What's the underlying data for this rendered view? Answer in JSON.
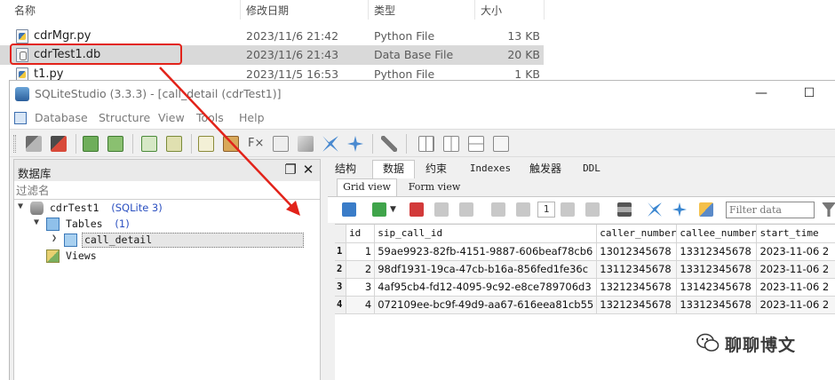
{
  "explorer": {
    "headers": {
      "name": "名称",
      "modified": "修改日期",
      "type": "类型",
      "size": "大小"
    },
    "files": [
      {
        "name": "cdrMgr.py",
        "modified": "2023/11/6 21:42",
        "type": "Python File",
        "size": "13 KB",
        "icon": "python-file-icon"
      },
      {
        "name": "cdrTest1.db",
        "modified": "2023/11/6 21:43",
        "type": "Data Base File",
        "size": "20 KB",
        "icon": "database-file-icon"
      },
      {
        "name": "t1.py",
        "modified": "2023/11/5 16:53",
        "type": "Python File",
        "size": "1 KB",
        "icon": "python-file-icon"
      }
    ]
  },
  "window": {
    "title": "SQLiteStudio (3.3.3) - [call_detail (cdrTest1)]",
    "minimize": "—",
    "maximize": "☐"
  },
  "menu": {
    "items": [
      "Database",
      "Structure",
      "View",
      "Tools",
      "Help"
    ]
  },
  "db_panel": {
    "title": "数据库",
    "restore": "❐",
    "close": "✕",
    "filter_placeholder": "过滤名",
    "tree": {
      "db_name": "cdrTest1",
      "db_type": "(SQLite 3)",
      "tables_label": "Tables",
      "tables_count": "(1)",
      "table_name": "call_detail",
      "views_label": "Views"
    }
  },
  "editor": {
    "tabs": [
      "结构",
      "数据",
      "约束",
      "Indexes",
      "触发器",
      "DDL"
    ],
    "active_tab": "数据",
    "subtabs": [
      "Grid view",
      "Form view"
    ],
    "active_subtab": "Grid view",
    "page": "1",
    "filter_placeholder": "Filter data",
    "columns": [
      "id",
      "sip_call_id",
      "caller_number",
      "callee_number",
      "start_time"
    ],
    "rows": [
      {
        "rownum": "1",
        "id": "1",
        "sip_call_id": "59ae9923-82fb-4151-9887-606beaf78cb6",
        "caller_number": "13012345678",
        "callee_number": "13312345678",
        "start_time": "2023-11-06 2"
      },
      {
        "rownum": "2",
        "id": "2",
        "sip_call_id": "98df1931-19ca-47cb-b16a-856fed1fe36c",
        "caller_number": "13112345678",
        "callee_number": "13312345678",
        "start_time": "2023-11-06 2"
      },
      {
        "rownum": "3",
        "id": "3",
        "sip_call_id": "4af95cb4-fd12-4095-9c92-e8ce789706d3",
        "caller_number": "13212345678",
        "callee_number": "13142345678",
        "start_time": "2023-11-06 2"
      },
      {
        "rownum": "4",
        "id": "4",
        "sip_call_id": "072109ee-bc9f-49d9-aa67-616eea81cb55",
        "caller_number": "13212345678",
        "callee_number": "13312345678",
        "start_time": "2023-11-06 2"
      }
    ]
  },
  "watermark": {
    "text": "聊聊博文"
  },
  "colors": {
    "highlight_red": "#e2231a",
    "link_blue": "#2a4fc0"
  }
}
